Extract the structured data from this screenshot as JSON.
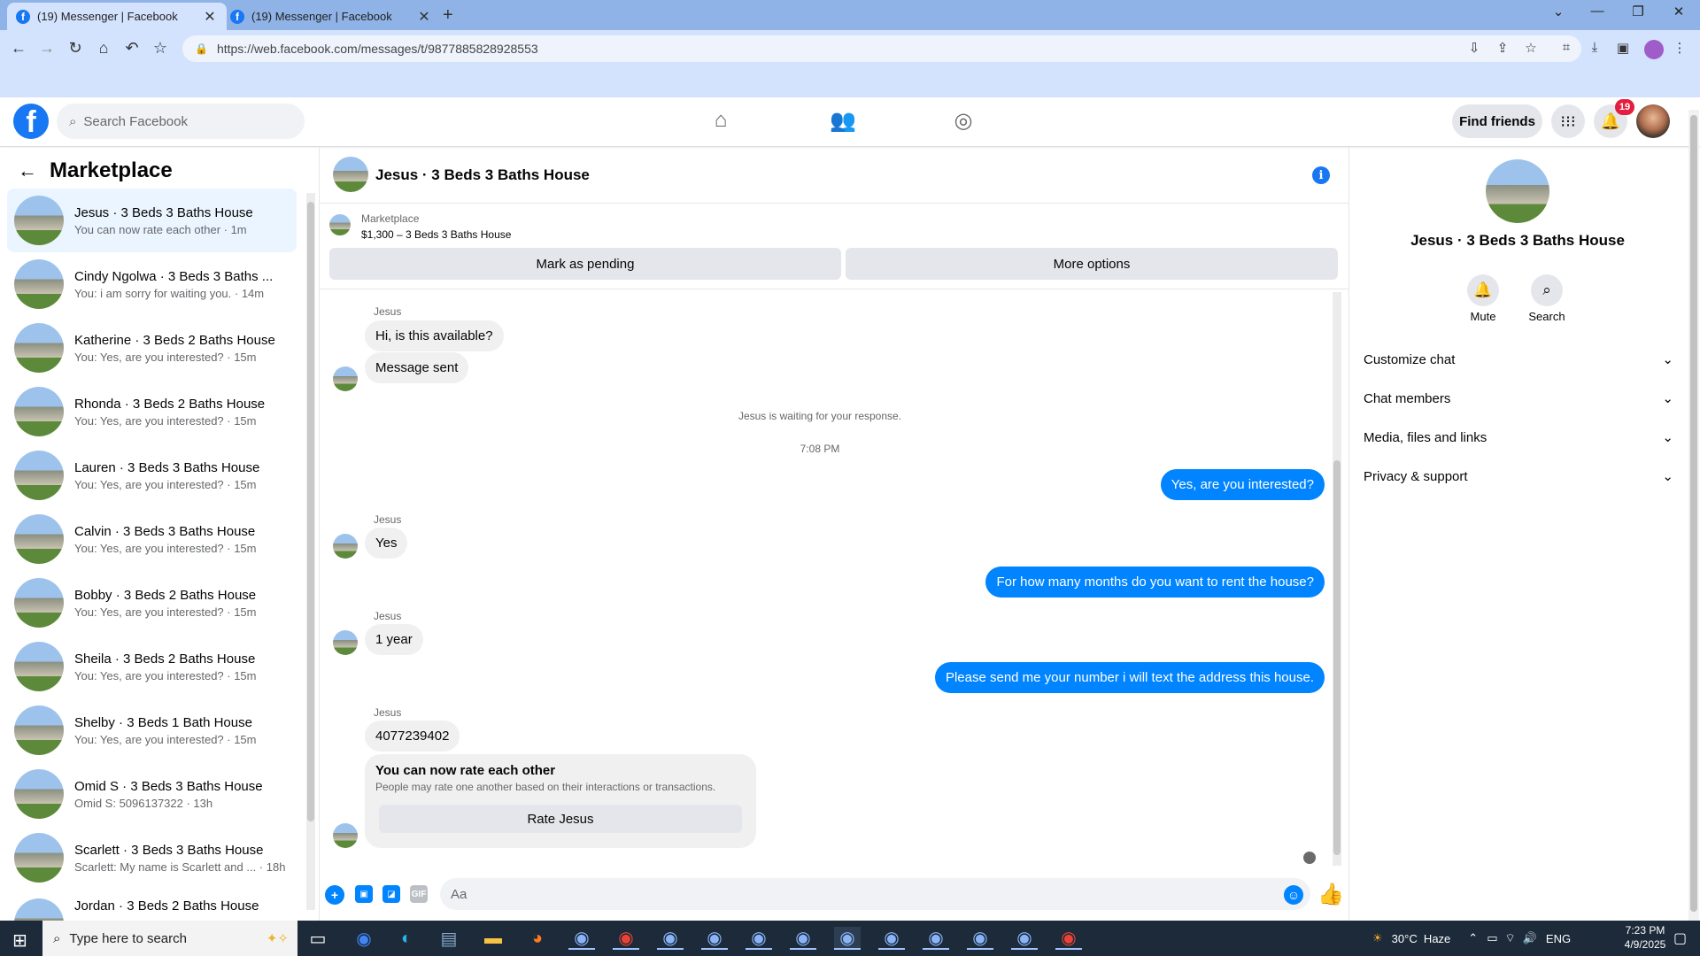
{
  "browser": {
    "tabs": [
      {
        "title": "(19) Messenger | Facebook",
        "active": true
      },
      {
        "title": "(19) Messenger | Facebook",
        "active": false
      }
    ],
    "url": "https://web.facebook.com/messages/t/9877885828928553"
  },
  "header": {
    "search_placeholder": "Search Facebook",
    "find_friends": "Find friends",
    "notification_count": "19"
  },
  "left": {
    "title": "Marketplace",
    "conversations": [
      {
        "name": "Jesus · 3 Beds 3 Baths House",
        "preview": "You can now rate each other · 1m",
        "active": true
      },
      {
        "name": "Cindy Ngolwa · 3 Beds 3 Baths ...",
        "preview": "You: i am sorry for waiting you. · 14m"
      },
      {
        "name": "Katherine · 3 Beds 2 Baths House",
        "preview": "You: Yes, are you interested? · 15m"
      },
      {
        "name": "Rhonda · 3 Beds 2 Baths House",
        "preview": "You: Yes, are you interested? · 15m"
      },
      {
        "name": "Lauren · 3 Beds 3 Baths House",
        "preview": "You: Yes, are you interested? · 15m"
      },
      {
        "name": "Calvin · 3 Beds 3 Baths House",
        "preview": "You: Yes, are you interested? · 15m"
      },
      {
        "name": "Bobby · 3 Beds 2 Baths House",
        "preview": "You: Yes, are you interested? · 15m"
      },
      {
        "name": "Sheila · 3 Beds 2 Baths House",
        "preview": "You: Yes, are you interested? · 15m"
      },
      {
        "name": "Shelby · 3 Beds 1 Bath House",
        "preview": "You: Yes, are you interested? · 15m"
      },
      {
        "name": "Omid S · 3 Beds 3 Baths House",
        "preview": "Omid S: 5096137322 · 13h"
      },
      {
        "name": "Scarlett · 3 Beds 3 Baths House",
        "preview": "Scarlett: My name is Scarlett and ... · 18h"
      },
      {
        "name": "Jordan · 3 Beds 2 Baths House",
        "preview": ""
      }
    ]
  },
  "chat": {
    "title": "Jesus · 3 Beds 3 Baths House",
    "marketplace_label": "Marketplace",
    "listing": "$1,300 – 3 Beds 3 Baths House",
    "mark_pending": "Mark as pending",
    "more_options": "More options",
    "sender_name": "Jesus",
    "msg1": "Hi, is this available?",
    "msg2": "Message sent",
    "waiting_note": "Jesus is waiting for your response.",
    "time_divider": "7:08 PM",
    "out1": "Yes, are you interested?",
    "in3": "Yes",
    "out2": "For how many months do you want to rent the house?",
    "in4": "1 year",
    "out3": "Please send me your number i will text the address this house.",
    "in5": "4077239402",
    "rate_title": "You can now rate each other",
    "rate_desc": "People may rate one another based on their interactions or transactions.",
    "rate_button": "Rate Jesus",
    "input_placeholder": "Aa"
  },
  "right": {
    "title": "Jesus · 3 Beds 3 Baths House",
    "mute": "Mute",
    "search": "Search",
    "sections": [
      "Customize chat",
      "Chat members",
      "Media, files and links",
      "Privacy & support"
    ]
  },
  "taskbar": {
    "search_placeholder": "Type here to search",
    "weather": "30°C  Haze",
    "lang": "ENG",
    "time": "7:23 PM",
    "date": "4/9/2025"
  },
  "colors": {
    "brand": "#1877f2",
    "outgoing": "#0084ff",
    "active_row": "#ebf5ff"
  }
}
